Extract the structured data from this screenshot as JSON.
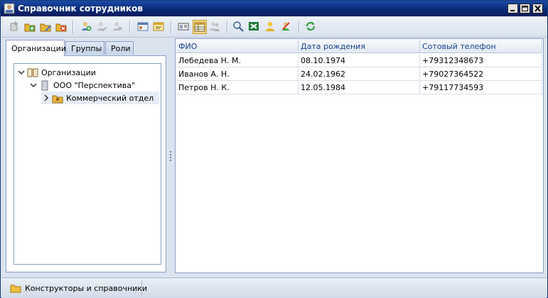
{
  "window": {
    "title": "Справочник сотрудников",
    "colors": {
      "title_bar": "#0b2a78",
      "frame": "#dbe3ef",
      "accent": "#15428b"
    }
  },
  "toolbar": {
    "buttons": [
      {
        "icon": "add-disabled-icon",
        "pressed": false
      },
      {
        "icon": "folder-add-icon",
        "pressed": false
      },
      {
        "icon": "folder-edit-icon",
        "pressed": false
      },
      {
        "icon": "folder-delete-icon",
        "pressed": false
      },
      {
        "icon": "user-add-icon",
        "pressed": false
      },
      {
        "icon": "user-edit-disabled-icon",
        "pressed": false
      },
      {
        "icon": "user-delete-disabled-icon",
        "pressed": false
      },
      {
        "icon": "card-icon",
        "pressed": false
      },
      {
        "icon": "card-yellow-icon",
        "pressed": false
      },
      {
        "icon": "id-card-icon",
        "pressed": false
      },
      {
        "icon": "grid-view-icon",
        "pressed": true
      },
      {
        "icon": "users-disabled-icon",
        "pressed": false
      },
      {
        "icon": "search-icon",
        "pressed": false
      },
      {
        "icon": "excel-icon",
        "pressed": false
      },
      {
        "icon": "user-yellow-icon",
        "pressed": false
      },
      {
        "icon": "user-remove-icon",
        "pressed": false
      },
      {
        "icon": "refresh-icon",
        "pressed": false
      }
    ]
  },
  "tabs": [
    {
      "label": "Организации",
      "active": true
    },
    {
      "label": "Группы",
      "active": false
    },
    {
      "label": "Роли",
      "active": false
    }
  ],
  "tree": {
    "root": {
      "label": "Организации",
      "icon": "book-icon",
      "expanded": true
    },
    "company": {
      "label": "ООО \"Перспектива\"",
      "icon": "building-icon",
      "expanded": true
    },
    "department": {
      "label": "Коммерческий отдел",
      "icon": "department-icon",
      "expanded": false,
      "selected": true
    }
  },
  "table": {
    "columns": [
      "ФИО",
      "Дата рождения",
      "Сотовый телефон"
    ],
    "rows": [
      [
        "Лебедева Н. М.",
        "08.10.1974",
        "+79312348673"
      ],
      [
        "Иванов А. Н.",
        "24.02.1962",
        "+79027364522"
      ],
      [
        "Петров Н. К.",
        "12.05.1984",
        "+79117734593"
      ]
    ]
  },
  "statusbar": {
    "item_label": "Конструкторы и справочники",
    "item_icon": "folder-icon"
  }
}
